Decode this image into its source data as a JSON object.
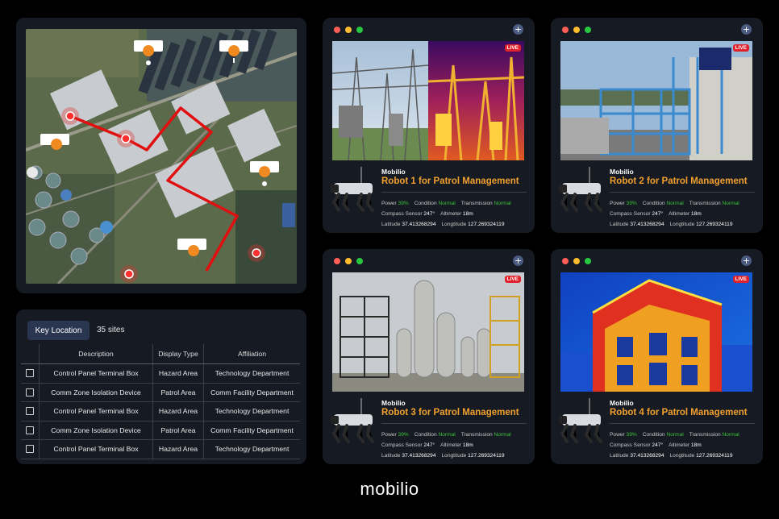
{
  "locations": {
    "button_label": "Key Location",
    "count_text": "35 sites",
    "columns": [
      "Description",
      "Display Type",
      "Affiliation"
    ],
    "rows": [
      {
        "description": "Control Panel Terminal Box",
        "display_type": "Hazard Area",
        "affiliation": "Technology Department"
      },
      {
        "description": "Comm Zone Isolation Device",
        "display_type": "Patrol Area",
        "affiliation": "Comm Facility Department"
      },
      {
        "description": "Control Panel Terminal Box",
        "display_type": "Hazard Area",
        "affiliation": "Technology Department"
      },
      {
        "description": "Comm Zone Isolation Device",
        "display_type": "Patrol Area",
        "affiliation": "Comm Facility Department"
      },
      {
        "description": "Control Panel Terminal Box",
        "display_type": "Hazard Area",
        "affiliation": "Technology Department"
      }
    ]
  },
  "robots": [
    {
      "brand": "Mobilio",
      "title": "Robot 1 for Patrol Management",
      "live": "LIVE",
      "power_label": "Power",
      "power": "39%",
      "condition_label": "Condition",
      "condition": "Normal",
      "transmission_label": "Transmission",
      "transmission": "Normal",
      "compass_label": "Compass Sensor",
      "compass": "247°",
      "altimeter_label": "Altimeter",
      "altimeter": "18m",
      "latitude_label": "Latitude",
      "latitude": "37.413268294",
      "longitude_label": "Longtitude",
      "longitude": "127.269324119"
    },
    {
      "brand": "Mobilio",
      "title": "Robot 2 for Patrol Management",
      "live": "LIVE",
      "power_label": "Power",
      "power": "39%",
      "condition_label": "Condition",
      "condition": "Normal",
      "transmission_label": "Transmission",
      "transmission": "Normal",
      "compass_label": "Compass Sensor",
      "compass": "247°",
      "altimeter_label": "Altimeter",
      "altimeter": "18m",
      "latitude_label": "Latitude",
      "latitude": "37.413268294",
      "longitude_label": "Longtitude",
      "longitude": "127.269324119"
    },
    {
      "brand": "Mobilio",
      "title": "Robot 3 for Patrol Management",
      "live": "LIVE",
      "power_label": "Power",
      "power": "39%",
      "condition_label": "Condition",
      "condition": "Normal",
      "transmission_label": "Transmission",
      "transmission": "Normal",
      "compass_label": "Compass Sensor",
      "compass": "247°",
      "altimeter_label": "Altimeter",
      "altimeter": "18m",
      "latitude_label": "Latitude",
      "latitude": "37.413268294",
      "longitude_label": "Longtitude",
      "longitude": "127.269324119"
    },
    {
      "brand": "Mobilio",
      "title": "Robot 4 for Patrol Management",
      "live": "LIVE",
      "power_label": "Power",
      "power": "39%",
      "condition_label": "Condition",
      "condition": "Normal",
      "transmission_label": "Transmission",
      "transmission": "Normal",
      "compass_label": "Compass Sensor",
      "compass": "247°",
      "altimeter_label": "Altimeter",
      "altimeter": "18m",
      "latitude_label": "Latitude",
      "latitude": "37.413268294",
      "longitude_label": "Longtitude",
      "longitude": "127.269324119"
    }
  ],
  "window_dots": [
    "#ff5f57",
    "#febc2e",
    "#28c840"
  ],
  "colors": {
    "accent": "#f0a030",
    "status_ok": "#3ec03e",
    "live": "#e0202a",
    "route": "#e01010"
  },
  "logo": "mobilio"
}
